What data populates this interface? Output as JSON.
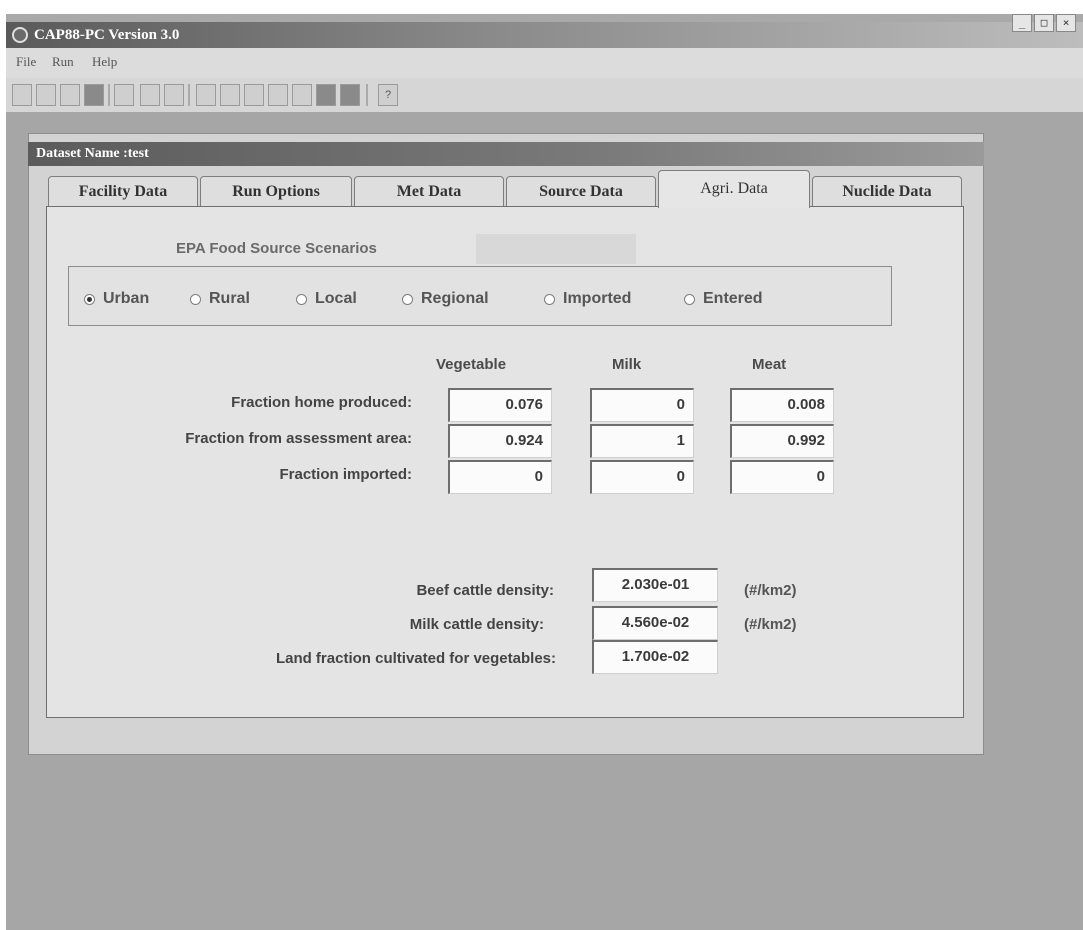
{
  "window": {
    "title": "CAP88-PC Version 3.0",
    "controls": [
      "_",
      "□",
      "×"
    ]
  },
  "menu": {
    "items": [
      "File",
      "Run",
      "Help"
    ]
  },
  "toolbar": {
    "help_label": "?"
  },
  "dialog": {
    "title": "Dataset Name :test",
    "tabs": [
      "Facility Data",
      "Run Options",
      "Met Data",
      "Source Data",
      "Agri. Data",
      "Nuclide Data"
    ],
    "active_tab": "Agri. Data"
  },
  "scenarios": {
    "label": "EPA Food Source Scenarios",
    "options": [
      "Urban",
      "Rural",
      "Local",
      "Regional",
      "Imported",
      "Entered"
    ],
    "selected": "Urban"
  },
  "fractions": {
    "columns": [
      "Vegetable",
      "Milk",
      "Meat"
    ],
    "rows": [
      {
        "label": "Fraction home produced:",
        "values": [
          "0.076",
          "0",
          "0.008"
        ]
      },
      {
        "label": "Fraction from assessment area:",
        "values": [
          "0.924",
          "1",
          "0.992"
        ]
      },
      {
        "label": "Fraction imported:",
        "values": [
          "0",
          "0",
          "0"
        ]
      }
    ]
  },
  "densities": [
    {
      "label": "Beef cattle density:",
      "value": "2.030e-01",
      "unit": "(#/km2)"
    },
    {
      "label": "Milk cattle density:",
      "value": "4.560e-02",
      "unit": "(#/km2)"
    },
    {
      "label": "Land fraction cultivated for vegetables:",
      "value": "1.700e-02",
      "unit": ""
    }
  ]
}
